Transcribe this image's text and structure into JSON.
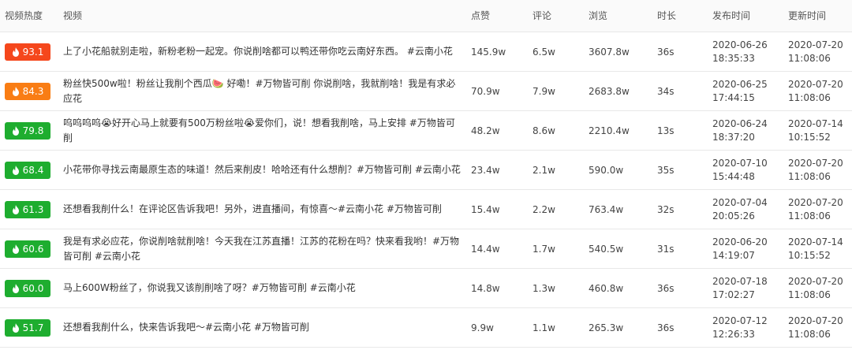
{
  "header": {
    "heat": "视频热度",
    "title": "视频",
    "likes": "点赞",
    "comments": "评论",
    "views": "浏览",
    "duration": "时长",
    "published": "发布时间",
    "updated": "更新时间"
  },
  "colors": {
    "hot": "#f5471c",
    "warm": "#f97d14",
    "normal": "#1ead2f"
  },
  "rows": [
    {
      "heat": "93.1",
      "level": "hot",
      "title": "上了小花船就别走啦，新粉老粉一起宠。你说削啥都可以鸭还带你吃云南好东西。 #云南小花",
      "likes": "145.9w",
      "comments": "6.5w",
      "views": "3607.8w",
      "duration": "36s",
      "pub_date": "2020-06-26",
      "pub_time": "18:35:33",
      "upd_date": "2020-07-20",
      "upd_time": "11:08:06"
    },
    {
      "heat": "84.3",
      "level": "warm",
      "title": "粉丝快500w啦！粉丝让我削个西瓜🍉 好嘞！#万物皆可削 你说削啥，我就削啥！我是有求必应花",
      "likes": "70.9w",
      "comments": "7.9w",
      "views": "2683.8w",
      "duration": "34s",
      "pub_date": "2020-06-25",
      "pub_time": "17:44:15",
      "upd_date": "2020-07-20",
      "upd_time": "11:08:06"
    },
    {
      "heat": "79.8",
      "level": "normal",
      "title": "呜呜呜呜😭好开心马上就要有500万粉丝啦😭爱你们，说！想看我削啥，马上安排 #万物皆可削",
      "likes": "48.2w",
      "comments": "8.6w",
      "views": "2210.4w",
      "duration": "13s",
      "pub_date": "2020-06-24",
      "pub_time": "18:37:20",
      "upd_date": "2020-07-14",
      "upd_time": "10:15:52"
    },
    {
      "heat": "68.4",
      "level": "normal",
      "title": "小花带你寻找云南最原生态的味道！然后来削皮！哈哈还有什么想削？#万物皆可削 #云南小花",
      "likes": "23.4w",
      "comments": "2.1w",
      "views": "590.0w",
      "duration": "35s",
      "pub_date": "2020-07-10",
      "pub_time": "15:44:48",
      "upd_date": "2020-07-20",
      "upd_time": "11:08:06"
    },
    {
      "heat": "61.3",
      "level": "normal",
      "title": "还想看我削什么！在评论区告诉我吧！另外，进直播间，有惊喜～#云南小花 #万物皆可削",
      "likes": "15.4w",
      "comments": "2.2w",
      "views": "763.4w",
      "duration": "32s",
      "pub_date": "2020-07-04",
      "pub_time": "20:05:26",
      "upd_date": "2020-07-20",
      "upd_time": "11:08:06"
    },
    {
      "heat": "60.6",
      "level": "normal",
      "title": "我是有求必应花，你说削啥就削啥！今天我在江苏直播！江苏的花粉在吗？快来看我哟！#万物皆可削 #云南小花",
      "likes": "14.4w",
      "comments": "1.7w",
      "views": "540.5w",
      "duration": "31s",
      "pub_date": "2020-06-20",
      "pub_time": "14:19:07",
      "upd_date": "2020-07-14",
      "upd_time": "10:15:52"
    },
    {
      "heat": "60.0",
      "level": "normal",
      "title": "马上600W粉丝了，你说我又该削削啥了呀？#万物皆可削 #云南小花",
      "likes": "14.8w",
      "comments": "1.3w",
      "views": "460.8w",
      "duration": "36s",
      "pub_date": "2020-07-18",
      "pub_time": "17:02:27",
      "upd_date": "2020-07-20",
      "upd_time": "11:08:06"
    },
    {
      "heat": "51.7",
      "level": "normal",
      "title": "还想看我削什么，快来告诉我吧～#云南小花 #万物皆可削",
      "likes": "9.9w",
      "comments": "1.1w",
      "views": "265.3w",
      "duration": "36s",
      "pub_date": "2020-07-12",
      "pub_time": "12:26:33",
      "upd_date": "2020-07-20",
      "upd_time": "11:08:06"
    }
  ]
}
